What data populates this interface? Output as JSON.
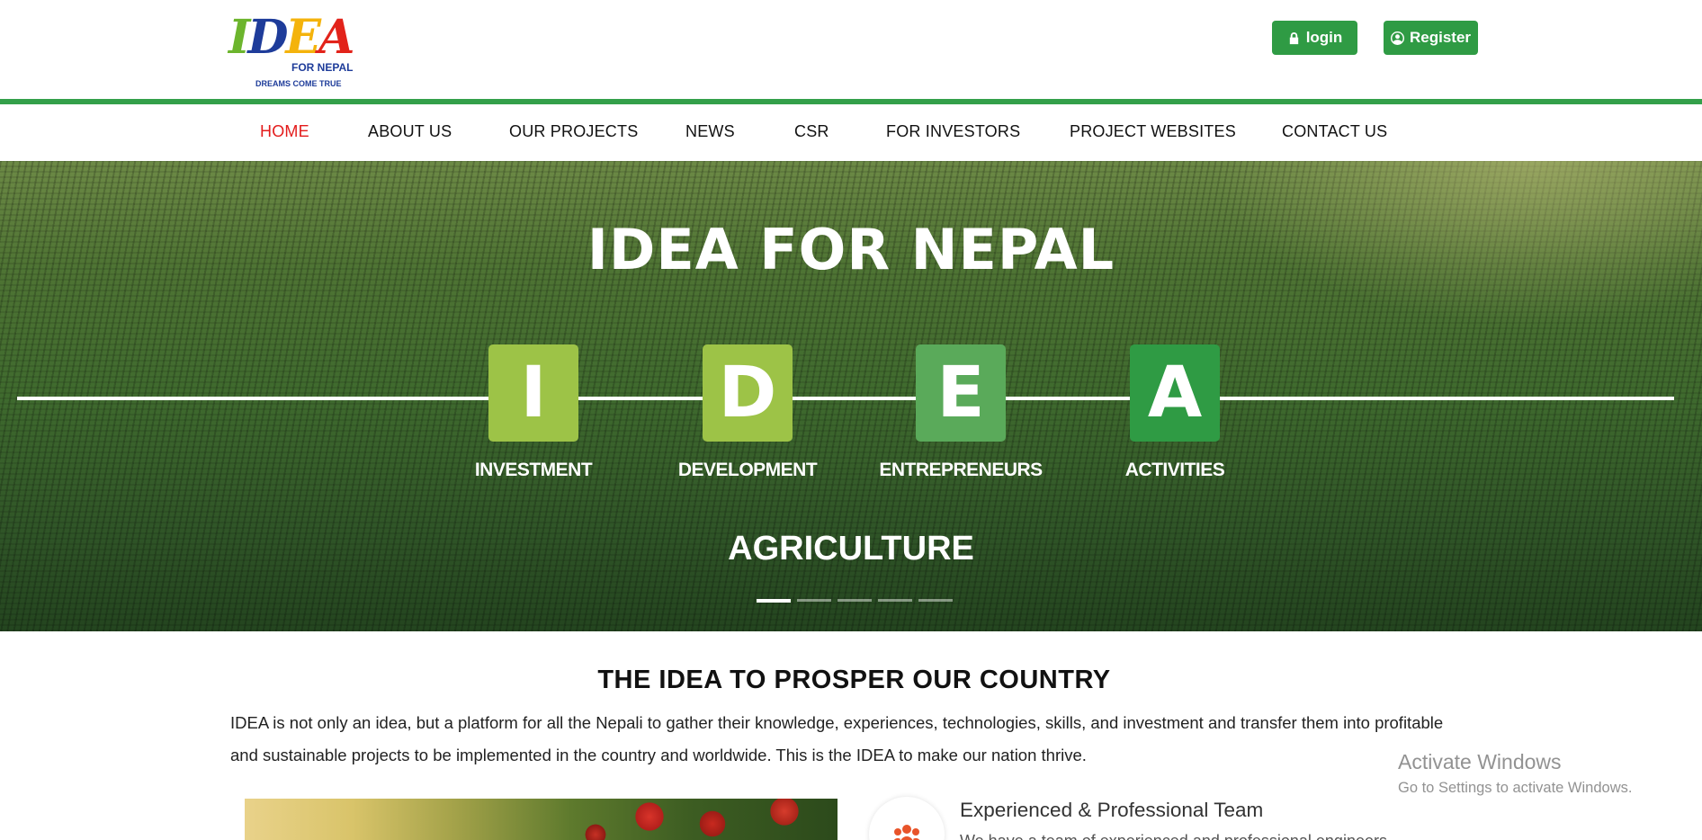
{
  "logo": {
    "letters": [
      "I",
      "D",
      "E",
      "A"
    ],
    "subtitle": "FOR NEPAL",
    "tagline": "DREAMS COME TRUE"
  },
  "auth": {
    "login_label": "login",
    "register_label": "Register",
    "button_color": "#2f9b44"
  },
  "nav": {
    "items": [
      {
        "label": "HOME",
        "active": true
      },
      {
        "label": "ABOUT US"
      },
      {
        "label": "OUR PROJECTS"
      },
      {
        "label": "NEWS"
      },
      {
        "label": "CSR"
      },
      {
        "label": "FOR INVESTORS"
      },
      {
        "label": "PROJECT WEBSITES"
      },
      {
        "label": "CONTACT US"
      }
    ],
    "active_color": "#e31b1b",
    "rule_color": "#33a04a"
  },
  "hero": {
    "title": "IDEA FOR NEPAL",
    "steps": [
      {
        "letter": "I",
        "label": "INVESTMENT",
        "color": "#9dc347"
      },
      {
        "letter": "D",
        "label": "DEVELOPMENT",
        "color": "#9dc347"
      },
      {
        "letter": "E",
        "label": "ENTREPRENEURS",
        "color": "#5aaa5a"
      },
      {
        "letter": "A",
        "label": "ACTIVITIES",
        "color": "#2f9b44"
      }
    ],
    "subtitle": "AGRICULTURE",
    "slides_total": 5,
    "active_slide": 1
  },
  "intro": {
    "title": "THE IDEA TO PROSPER OUR COUNTRY",
    "text": "IDEA is not only an idea, but a platform for all the Nepali to gather their knowledge, experiences, technologies, skills, and investment and transfer them into profitable and sustainable projects to be implemented in the country and worldwide. This is the IDEA to make our nation thrive."
  },
  "feature": {
    "icon": "team-icon",
    "title": "Experienced & Professional Team",
    "text": "We have a team of experienced and professional engineers"
  },
  "watermark": {
    "line1": "Activate Windows",
    "line2": "Go to Settings to activate Windows."
  }
}
